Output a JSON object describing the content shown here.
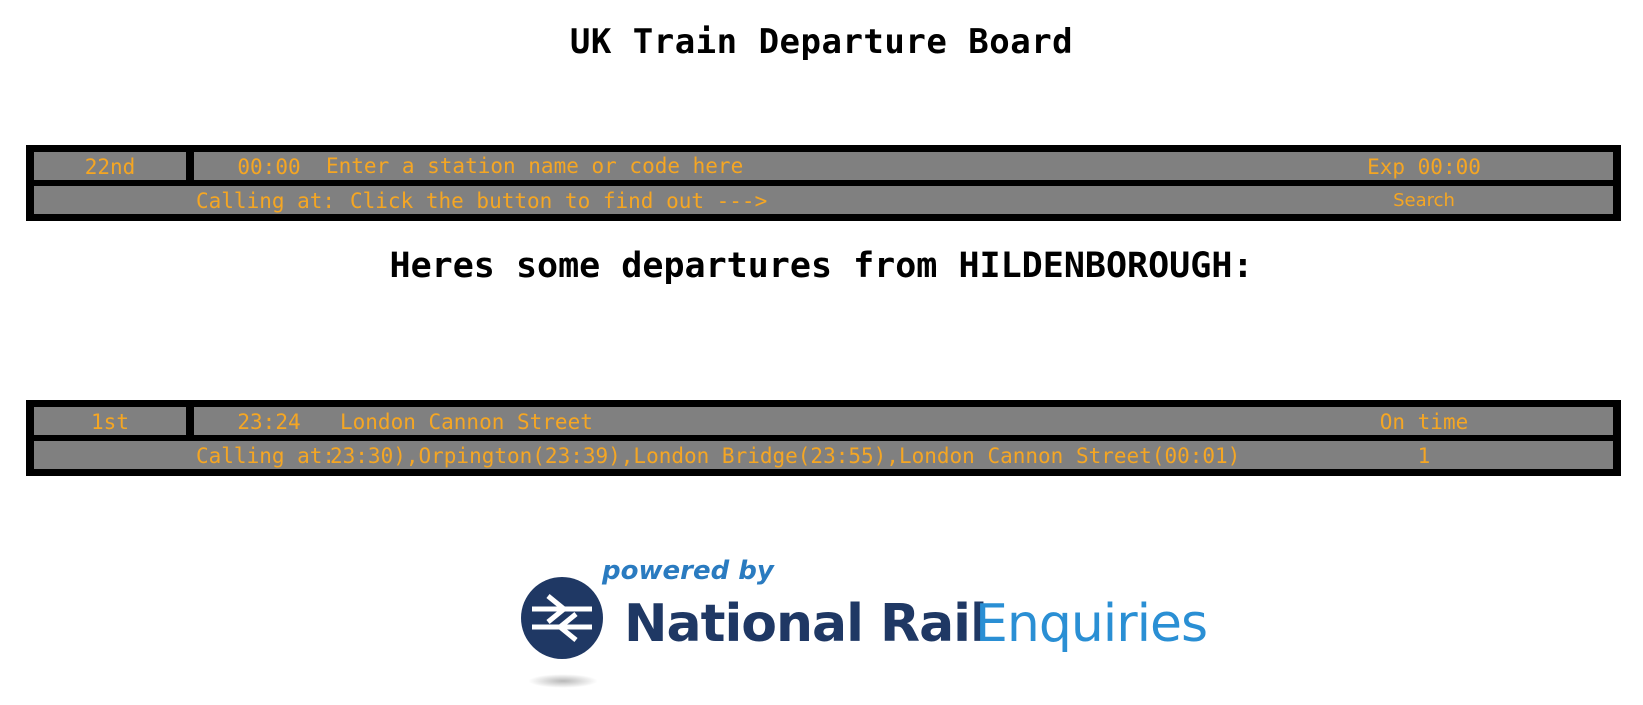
{
  "page": {
    "title": "UK Train Departure Board",
    "subheading": "Heres some departures from HILDENBOROUGH:"
  },
  "search_board": {
    "ordinal": "22nd",
    "time": "00:00",
    "station_placeholder": "Enter a station name or code here",
    "station_value": "",
    "status": "Exp 00:00",
    "calling_label": "Calling at:",
    "calling_text": "Click the button to find out --->",
    "search_label": "Search"
  },
  "departures": [
    {
      "ordinal": "1st",
      "time": "23:24",
      "destination": "London Cannon Street",
      "status": "On time",
      "calling_label": "Calling at:",
      "calling_points": "23:30),Orpington(23:39),London Bridge(23:55),London Cannon Street(00:01)",
      "platform": "1"
    }
  ],
  "footer_logo": {
    "powered_by": "powered by",
    "brand_primary": "National Rail",
    "brand_secondary": "Enquiries",
    "colors": {
      "navy": "#1f3864",
      "blue": "#2a8fd4"
    }
  },
  "theme": {
    "board_background": "#000000",
    "row_background": "#808080",
    "text_color": "#f5a623"
  }
}
